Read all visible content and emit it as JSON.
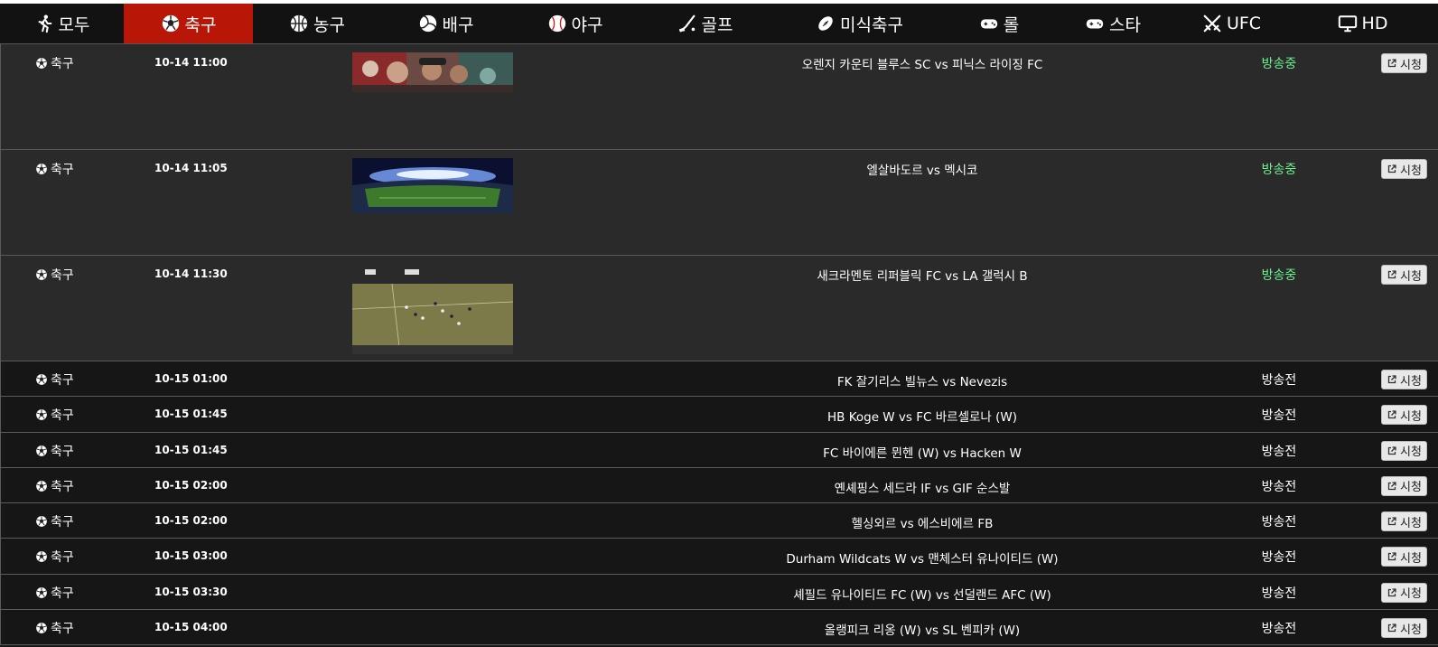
{
  "nav": {
    "tabs": [
      {
        "label": "모두",
        "icon": "running-icon",
        "name": "tab-all",
        "active": false
      },
      {
        "label": "축구",
        "icon": "soccer-ball-icon",
        "name": "tab-soccer",
        "active": true
      },
      {
        "label": "농구",
        "icon": "basketball-icon",
        "name": "tab-basketball",
        "active": false
      },
      {
        "label": "배구",
        "icon": "volleyball-icon",
        "name": "tab-volleyball",
        "active": false
      },
      {
        "label": "야구",
        "icon": "baseball-icon",
        "name": "tab-baseball",
        "active": false
      },
      {
        "label": "골프",
        "icon": "golf-icon",
        "name": "tab-golf",
        "active": false
      },
      {
        "label": "미식축구",
        "icon": "football-icon",
        "name": "tab-american-football",
        "active": false
      },
      {
        "label": "롤",
        "icon": "gamepad-icon",
        "name": "tab-lol",
        "active": false
      },
      {
        "label": "스타",
        "icon": "gamepad-icon",
        "name": "tab-starcraft",
        "active": false
      },
      {
        "label": "UFC",
        "icon": "crossed-swords-icon",
        "name": "tab-ufc",
        "active": false
      },
      {
        "label": "HD",
        "icon": "monitor-icon",
        "name": "tab-hd",
        "active": false
      }
    ]
  },
  "colors": {
    "active_tab": "#b81707",
    "live_status": "#6cf08d",
    "live_row_bg": "#2a2a2a",
    "pre_row_bg": "#161616"
  },
  "watch_label": "시청",
  "rows": [
    {
      "category": "축구",
      "time": "10-14 11:00",
      "match": "오렌지 카운티 블루스 SC vs 피닉스 라이징 FC",
      "status": "방송중",
      "live": true,
      "thumb": "crowd-thumbnail"
    },
    {
      "category": "축구",
      "time": "10-14 11:05",
      "match": "엘살바도르 vs 멕시코",
      "status": "방송중",
      "live": true,
      "thumb": "stadium-thumbnail"
    },
    {
      "category": "축구",
      "time": "10-14 11:30",
      "match": "새크라멘토 리퍼블릭 FC vs LA 갤럭시 B",
      "status": "방송중",
      "live": true,
      "thumb": "pitch-thumbnail"
    },
    {
      "category": "축구",
      "time": "10-15 01:00",
      "match": "FK 잘기리스 빌뉴스 vs Nevezis",
      "status": "방송전",
      "live": false
    },
    {
      "category": "축구",
      "time": "10-15 01:45",
      "match": "HB Koge W vs FC 바르셀로나 (W)",
      "status": "방송전",
      "live": false
    },
    {
      "category": "축구",
      "time": "10-15 01:45",
      "match": "FC 바이에른 뮌헨 (W) vs Hacken W",
      "status": "방송전",
      "live": false
    },
    {
      "category": "축구",
      "time": "10-15 02:00",
      "match": "옌셰핑스 세드라 IF vs GIF 순스발",
      "status": "방송전",
      "live": false
    },
    {
      "category": "축구",
      "time": "10-15 02:00",
      "match": "헬싱외르 vs 에스비에르 FB",
      "status": "방송전",
      "live": false
    },
    {
      "category": "축구",
      "time": "10-15 03:00",
      "match": "Durham Wildcats W vs 맨체스터 유나이티드 (W)",
      "status": "방송전",
      "live": false
    },
    {
      "category": "축구",
      "time": "10-15 03:30",
      "match": "셰필드 유나이티드 FC (W) vs 선덜랜드 AFC (W)",
      "status": "방송전",
      "live": false
    },
    {
      "category": "축구",
      "time": "10-15 04:00",
      "match": "올랭피크 리옹 (W) vs SL 벤피카 (W)",
      "status": "방송전",
      "live": false
    }
  ]
}
